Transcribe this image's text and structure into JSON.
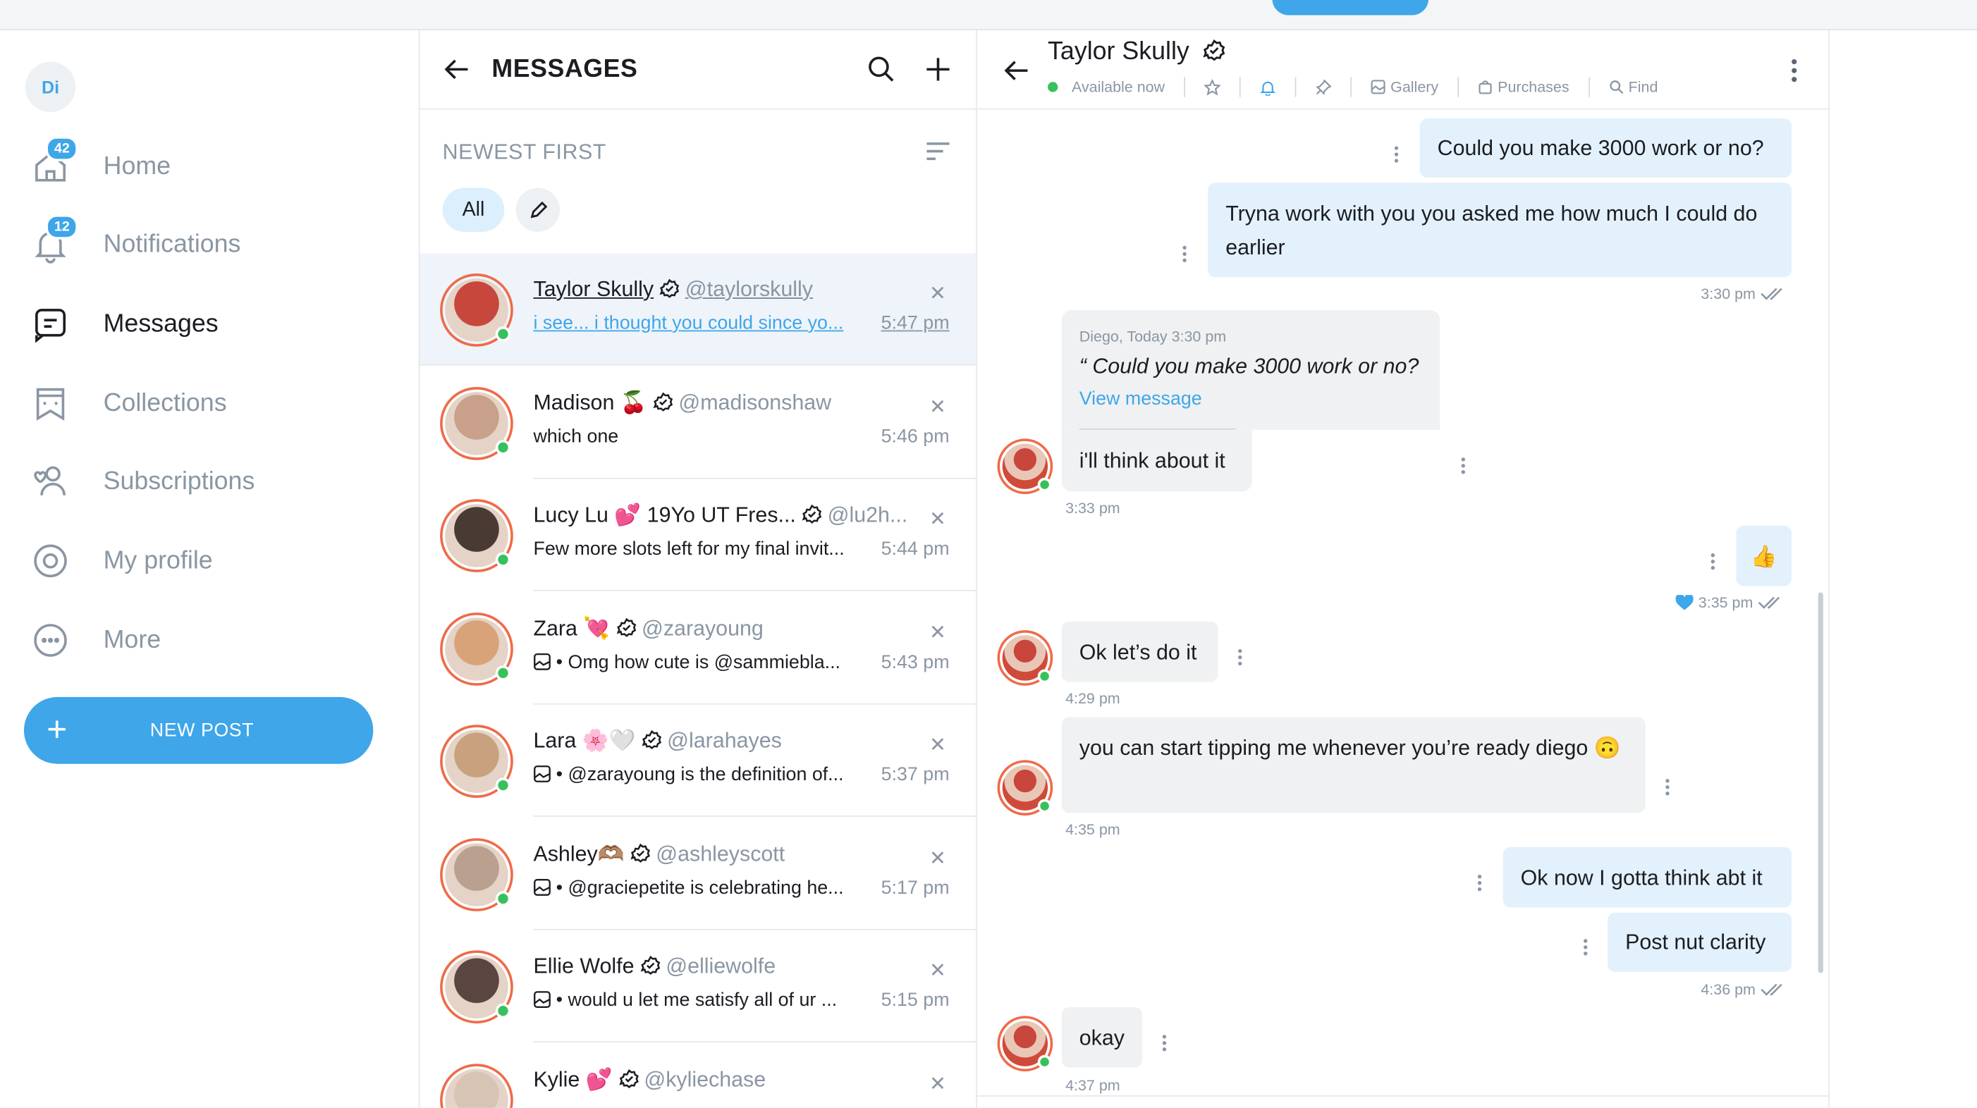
{
  "nav": {
    "avatar_initials": "Di",
    "items": [
      {
        "label": "Home",
        "badge": "42",
        "icon": "home-icon"
      },
      {
        "label": "Notifications",
        "badge": "12",
        "icon": "bell-icon"
      },
      {
        "label": "Messages",
        "badge": "",
        "icon": "message-icon"
      },
      {
        "label": "Collections",
        "badge": "",
        "icon": "collections-icon"
      },
      {
        "label": "Subscriptions",
        "badge": "",
        "icon": "subscriptions-icon"
      },
      {
        "label": "My profile",
        "badge": "",
        "icon": "profile-icon"
      },
      {
        "label": "More",
        "badge": "",
        "icon": "more-icon"
      }
    ],
    "new_post_label": "NEW POST"
  },
  "messages": {
    "title": "MESSAGES",
    "sort_label": "NEWEST FIRST",
    "filter_all": "All",
    "conversations": [
      {
        "name": "Taylor Skully",
        "handle": "@taylorskully",
        "preview": "i see... i thought you could since yo...",
        "time": "5:47 pm",
        "has_image": false,
        "color": "#c7473d"
      },
      {
        "name": "Madison 🍒",
        "handle": "@madisonshaw",
        "preview": "which one",
        "time": "5:46 pm",
        "has_image": false,
        "color": "#c9a08a"
      },
      {
        "name": "Lucy Lu 💕 19Yo UT Fres...",
        "handle": "@lu2h...",
        "preview": "Few more slots left for my final invit...",
        "time": "5:44 pm",
        "has_image": false,
        "color": "#4a3a34"
      },
      {
        "name": "Zara 💘",
        "handle": "@zarayoung",
        "preview": "• Omg how cute is @sammiebla...",
        "time": "5:43 pm",
        "has_image": true,
        "color": "#d9a37a"
      },
      {
        "name": "Lara 🌸🤍",
        "handle": "@larahayes",
        "preview": "• @zarayoung is the definition of...",
        "time": "5:37 pm",
        "has_image": true,
        "color": "#c8a27e"
      },
      {
        "name": "Ashley🫶🏽",
        "handle": "@ashleyscott",
        "preview": "• @graciepetite is celebrating he...",
        "time": "5:17 pm",
        "has_image": true,
        "color": "#b9a08f"
      },
      {
        "name": "Ellie Wolfe",
        "handle": "@elliewolfe",
        "preview": "• would u let me satisfy all of ur ...",
        "time": "5:15 pm",
        "has_image": true,
        "color": "#5a4540"
      },
      {
        "name": "Kylie 💕",
        "handle": "@kyliechase",
        "preview": "",
        "time": "",
        "has_image": false,
        "color": "#d8c4b4"
      }
    ]
  },
  "chat": {
    "name": "Taylor Skully",
    "status": "Available now",
    "tools": {
      "gallery": "Gallery",
      "purchases": "Purchases",
      "find": "Find"
    },
    "msg1": "Could you make 3000 work or no?",
    "msg2": "Tryna work with you you asked me how much I could do earlier",
    "time1": "3:30 pm",
    "reply_meta": "Diego, Today 3:30 pm",
    "reply_quote": "“ Could you make 3000 work or no?",
    "view_message": "View message",
    "msg3": "i'll think about it",
    "time2": "3:33 pm",
    "msg4": "👍",
    "time3": "3:35 pm",
    "msg5": "Ok let’s do it",
    "time4": "4:29 pm",
    "msg6": "you can start tipping me whenever you’re ready diego 🙃",
    "time5": "4:35 pm",
    "msg7": "Ok now I gotta think abt it",
    "msg8": "Post nut clarity",
    "time6": "4:36 pm",
    "msg9": "okay",
    "time7": "4:37 pm"
  },
  "colors": {
    "accent": "#3ea6e9",
    "online": "#37c15d",
    "ring": "#f06a48"
  }
}
